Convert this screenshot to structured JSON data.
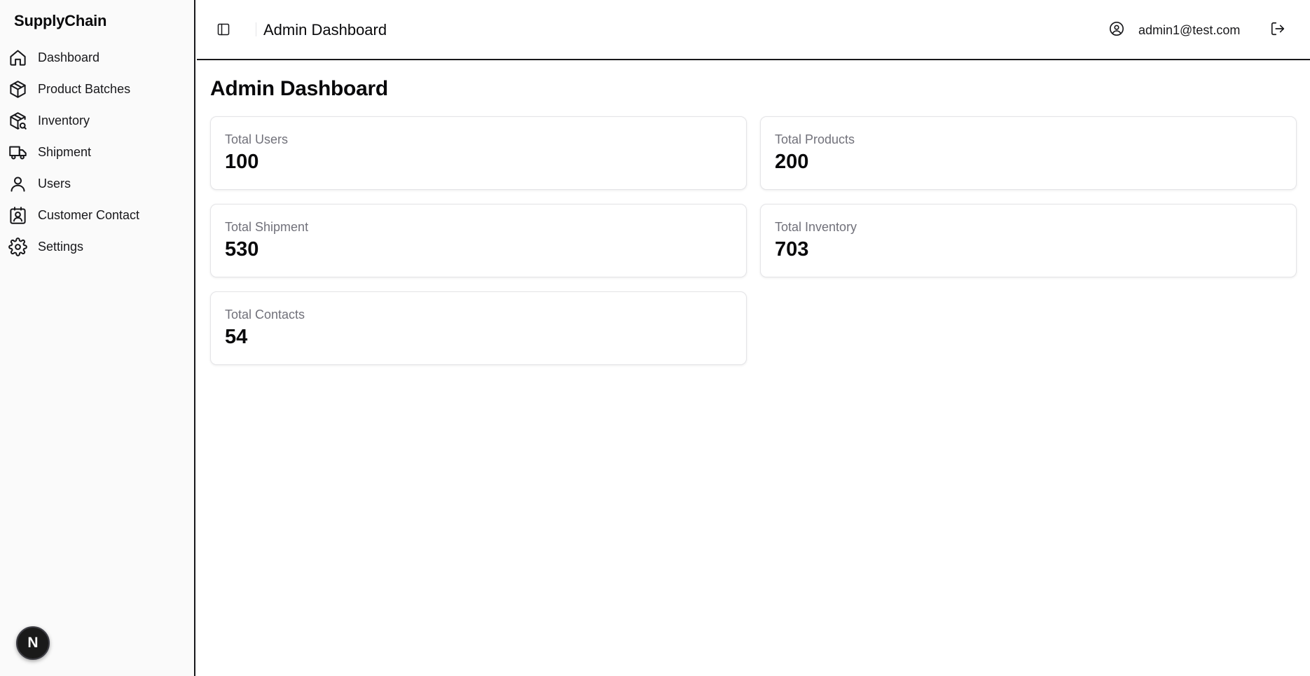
{
  "brand": "SupplyChain",
  "nav": [
    {
      "label": "Dashboard",
      "icon": "home-icon"
    },
    {
      "label": "Product Batches",
      "icon": "package-icon"
    },
    {
      "label": "Inventory",
      "icon": "package-search-icon"
    },
    {
      "label": "Shipment",
      "icon": "truck-icon"
    },
    {
      "label": "Users",
      "icon": "user-icon"
    },
    {
      "label": "Customer Contact",
      "icon": "contact-icon"
    },
    {
      "label": "Settings",
      "icon": "gear-icon"
    }
  ],
  "header": {
    "title": "Admin Dashboard",
    "user_email": "admin1@test.com"
  },
  "page": {
    "title": "Admin Dashboard"
  },
  "stats": [
    {
      "label": "Total Users",
      "value": "100"
    },
    {
      "label": "Total Products",
      "value": "200"
    },
    {
      "label": "Total Shipment",
      "value": "530"
    },
    {
      "label": "Total Inventory",
      "value": "703"
    },
    {
      "label": "Total Contacts",
      "value": "54"
    }
  ],
  "badge": {
    "letter": "N"
  }
}
